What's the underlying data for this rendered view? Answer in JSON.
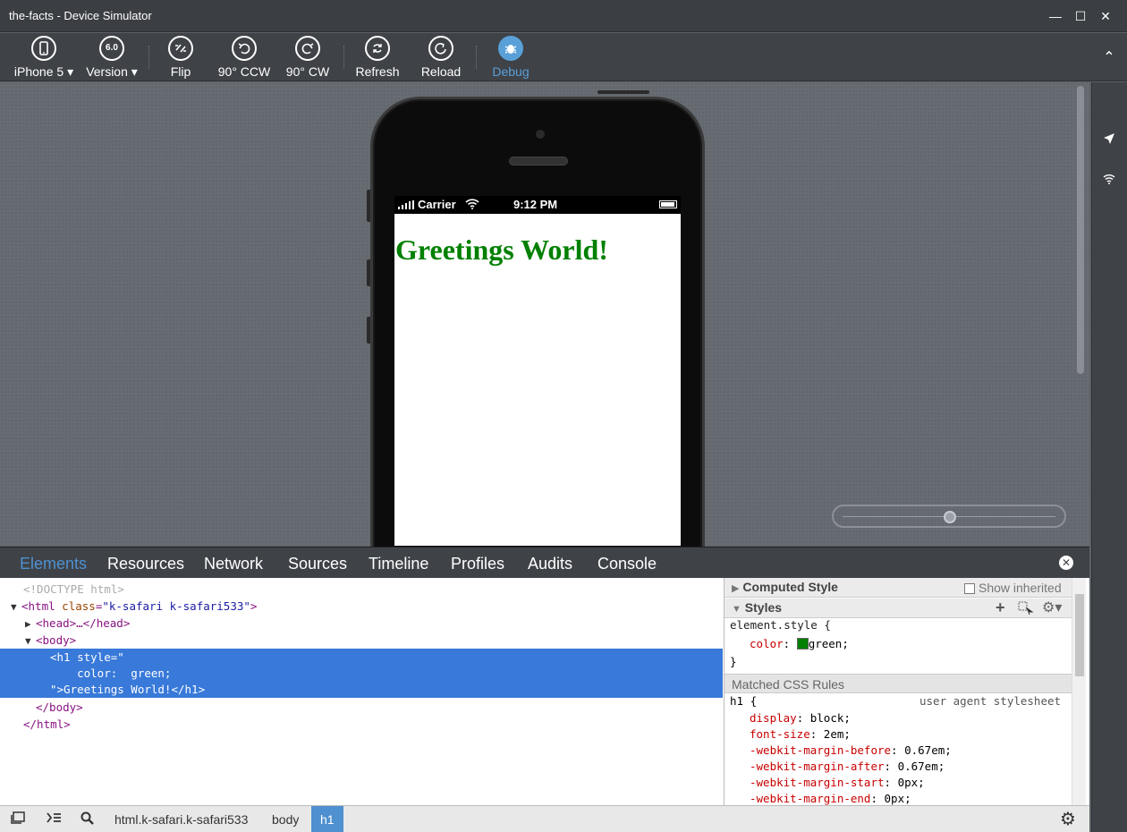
{
  "window": {
    "title": "the-facts - Device Simulator",
    "controls": {
      "minimize": "—",
      "maximize": "☐",
      "close": "✕"
    }
  },
  "toolbar": {
    "items": [
      {
        "label": "iPhone 5 ▾",
        "icon": "phone-icon"
      },
      {
        "label": "Version ▾",
        "icon": "version-badge",
        "badge": "6.0"
      },
      {
        "label": "Flip",
        "icon": "flip-icon"
      },
      {
        "label": "90° CCW",
        "icon": "rotate-ccw-icon"
      },
      {
        "label": "90° CW",
        "icon": "rotate-cw-icon"
      },
      {
        "label": "Refresh",
        "icon": "refresh-icon"
      },
      {
        "label": "Reload",
        "icon": "reload-icon"
      },
      {
        "label": "Debug",
        "icon": "bug-icon",
        "color": "#5aa0d8"
      }
    ],
    "collapse_glyph": "⌃"
  },
  "sidebar": {
    "icons": [
      "location-arrow-icon",
      "wifi-icon"
    ]
  },
  "device": {
    "statusbar": {
      "carrier": "Carrier",
      "time": "9:12 PM"
    },
    "page": {
      "heading": "Greetings World!",
      "heading_color": "green"
    }
  },
  "devtools": {
    "tabs": [
      "Elements",
      "Resources",
      "Network",
      "Sources",
      "Timeline",
      "Profiles",
      "Audits",
      "Console"
    ],
    "active_tab": "Elements",
    "dom": {
      "doctype": "<!DOCTYPE html>",
      "html_open_tag": "<html",
      "html_attr": "class",
      "html_value": "\"k-safari k-safari533\"",
      "html_close": ">",
      "head": "<head>…</head>",
      "body_open": "<body>",
      "h1_line1": "<h1 style=\"",
      "h1_line2": "    color:  green;",
      "h1_line3": "\">Greetings World!</h1>",
      "body_close": "</body>",
      "html_close_tag": "</html>"
    },
    "styles": {
      "computed_title": "Computed Style",
      "show_inherited": "Show inherited",
      "styles_title": "Styles",
      "element_style_open": "element.style {",
      "element_prop": "color",
      "element_value": "green;",
      "element_swatch": "#008000",
      "element_style_close": "}",
      "matched_title": "Matched CSS Rules",
      "rule_selector": "h1 {",
      "rule_source": "user agent stylesheet",
      "rules": [
        {
          "prop": "display",
          "value": "block;"
        },
        {
          "prop": "font-size",
          "value": "2em;"
        },
        {
          "prop": "-webkit-margin-before",
          "value": "0.67em;"
        },
        {
          "prop": "-webkit-margin-after",
          "value": "0.67em;"
        },
        {
          "prop": "-webkit-margin-start",
          "value": "0px;"
        },
        {
          "prop": "-webkit-margin-end",
          "value": "0px;"
        }
      ]
    },
    "breadcrumbs": [
      "html.k-safari.k-safari533",
      "body",
      "h1"
    ],
    "active_breadcrumb": "h1"
  }
}
